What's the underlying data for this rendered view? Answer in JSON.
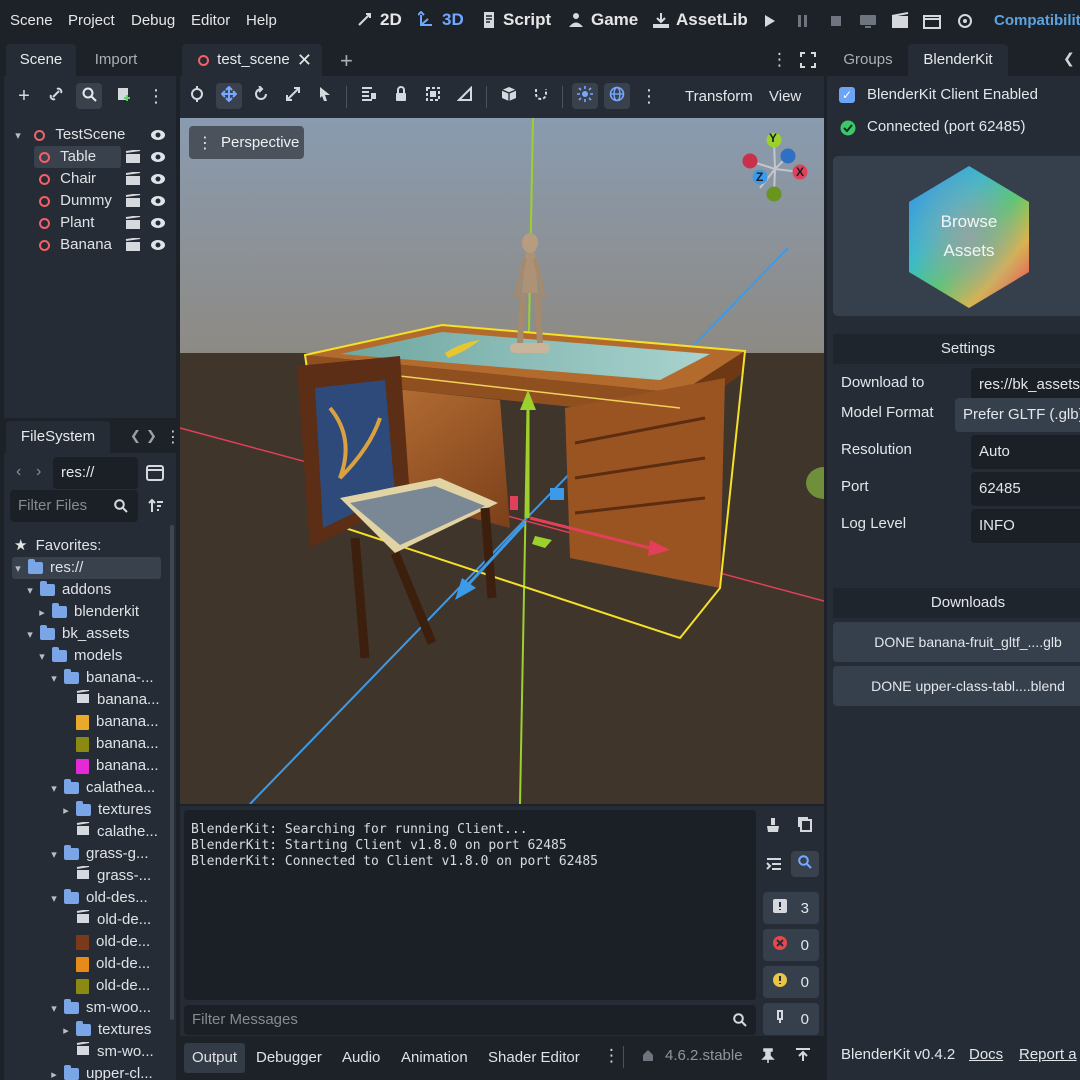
{
  "menu": [
    "Scene",
    "Project",
    "Debug",
    "Editor",
    "Help"
  ],
  "workspaces": [
    {
      "label": "2D",
      "icon": "2d-icon"
    },
    {
      "label": "3D",
      "icon": "3d-icon"
    },
    {
      "label": "Script",
      "icon": "script-icon"
    },
    {
      "label": "Game",
      "icon": "game-icon"
    },
    {
      "label": "AssetLib",
      "icon": "assetlib-icon"
    }
  ],
  "renderer_label": "Compatibility",
  "scene_dock": {
    "tabs": [
      "Scene",
      "Import"
    ],
    "tree": [
      {
        "label": "TestScene",
        "level": 0
      },
      {
        "label": "Table",
        "level": 1
      },
      {
        "label": "Chair",
        "level": 1
      },
      {
        "label": "Dummy",
        "level": 1
      },
      {
        "label": "Plant",
        "level": 1
      },
      {
        "label": "Banana",
        "level": 1
      }
    ]
  },
  "filesystem": {
    "title": "FileSystem",
    "path": "res://",
    "filter_placeholder": "Filter Files",
    "favorites_label": "Favorites:",
    "items": [
      {
        "label": "res://",
        "level": 0,
        "type": "folder",
        "arrow": "down"
      },
      {
        "label": "addons",
        "level": 1,
        "type": "folder",
        "arrow": "down"
      },
      {
        "label": "blenderkit",
        "level": 2,
        "type": "folder",
        "arrow": "right"
      },
      {
        "label": "bk_assets",
        "level": 1,
        "type": "folder",
        "arrow": "down"
      },
      {
        "label": "models",
        "level": 2,
        "type": "folder",
        "arrow": "down"
      },
      {
        "label": "banana-...",
        "level": 3,
        "type": "folder",
        "arrow": "down"
      },
      {
        "label": "banana...",
        "level": 4,
        "type": "scene"
      },
      {
        "label": "banana...",
        "level": 4,
        "type": "tex-yellow"
      },
      {
        "label": "banana...",
        "level": 4,
        "type": "tex-olive"
      },
      {
        "label": "banana...",
        "level": 4,
        "type": "tex-magenta"
      },
      {
        "label": "calathea...",
        "level": 3,
        "type": "folder",
        "arrow": "down"
      },
      {
        "label": "textures",
        "level": 4,
        "type": "folder",
        "arrow": "right"
      },
      {
        "label": "calathe...",
        "level": 4,
        "type": "scene"
      },
      {
        "label": "grass-g...",
        "level": 3,
        "type": "folder",
        "arrow": "down"
      },
      {
        "label": "grass-...",
        "level": 4,
        "type": "scene"
      },
      {
        "label": "old-des...",
        "level": 3,
        "type": "folder",
        "arrow": "down"
      },
      {
        "label": "old-de...",
        "level": 4,
        "type": "scene"
      },
      {
        "label": "old-de...",
        "level": 4,
        "type": "tex-brown"
      },
      {
        "label": "old-de...",
        "level": 4,
        "type": "tex-orange"
      },
      {
        "label": "old-de...",
        "level": 4,
        "type": "tex-olive"
      },
      {
        "label": "sm-woo...",
        "level": 3,
        "type": "folder",
        "arrow": "down"
      },
      {
        "label": "textures",
        "level": 4,
        "type": "folder",
        "arrow": "right"
      },
      {
        "label": "sm-wo...",
        "level": 4,
        "type": "scene"
      },
      {
        "label": "upper-cl...",
        "level": 3,
        "type": "folder",
        "arrow": "right"
      }
    ]
  },
  "editor_tab": {
    "label": "test_scene"
  },
  "viewport": {
    "perspective_label": "Perspective",
    "menus": [
      "Transform",
      "View"
    ],
    "gizmo_axes": [
      "Y",
      "X",
      "Z"
    ]
  },
  "output": {
    "lines": [
      "BlenderKit: Searching for running Client...",
      "BlenderKit: Starting Client v1.8.0 on port 62485",
      "BlenderKit: Connected to Client v1.8.0 on port 62485"
    ],
    "filter_placeholder": "Filter Messages",
    "counters": [
      {
        "icon": "message-icon",
        "value": "3",
        "color": "#e6e6e6"
      },
      {
        "icon": "error-icon",
        "value": "0",
        "color": "#e5484d"
      },
      {
        "icon": "warning-icon",
        "value": "0",
        "color": "#e8c547"
      },
      {
        "icon": "debug-icon",
        "value": "0",
        "color": "#e6e6e6"
      }
    ]
  },
  "bottom_tabs": [
    "Output",
    "Debugger",
    "Audio",
    "Animation",
    "Shader Editor"
  ],
  "version_label": "4.6.2.stable",
  "blenderkit": {
    "tabs": [
      "Groups",
      "BlenderKit"
    ],
    "client_enabled_label": "BlenderKit Client Enabled",
    "connected_label": "Connected (port 62485)",
    "browse_label_line1": "Browse",
    "browse_label_line2": "Assets",
    "settings_title": "Settings",
    "settings": [
      {
        "label": "Download to",
        "value": "res://bk_assets"
      },
      {
        "label": "Model Format",
        "value": "Prefer GLTF (.glb)"
      },
      {
        "label": "Resolution",
        "value": "Auto"
      },
      {
        "label": "Port",
        "value": "62485"
      },
      {
        "label": "Log Level",
        "value": "INFO"
      }
    ],
    "downloads_title": "Downloads",
    "downloads": [
      "DONE banana-fruit_gltf_....glb",
      "DONE upper-class-tabl....blend"
    ],
    "footer_version": "BlenderKit v0.4.2",
    "docs_label": "Docs",
    "report_label": "Report a"
  }
}
